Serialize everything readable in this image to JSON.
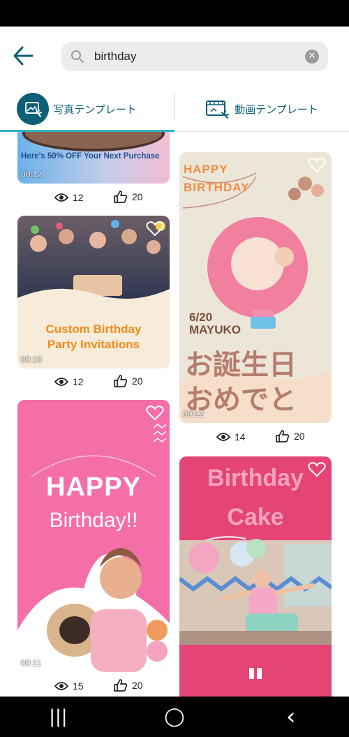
{
  "search": {
    "query": "birthday",
    "clear_symbol": "✕"
  },
  "tabs": [
    {
      "label": "写真テンプレート",
      "active": true
    },
    {
      "label": "動画テンプレート",
      "active": false
    }
  ],
  "cards": [
    {
      "id": "c0",
      "text": "Here's 50% OFF Your Next Purchase",
      "duration": "00:12",
      "views": "12",
      "likes": "20"
    },
    {
      "id": "c1",
      "title_line1": "Custom Birthday",
      "title_line2": "Party Invitations",
      "duration": "00:10",
      "views": "12",
      "likes": "20"
    },
    {
      "id": "c2",
      "banner": "HAPPY BIRTHDAY",
      "date_name": "6/20 MAYUKO",
      "jp_line1": "お誕生日",
      "jp_line2": "おめでとう!",
      "duration": "00:12",
      "views": "14",
      "likes": "20"
    },
    {
      "id": "c3",
      "line1": "HAPPY",
      "line2": "Birthday!!",
      "duration": "00:11",
      "views": "15",
      "likes": "20"
    },
    {
      "id": "c4",
      "line1": "Birthday",
      "line2": "Cake"
    }
  ],
  "navbar": {
    "recents": "|||",
    "home": "◯",
    "back": "‹"
  },
  "colors": {
    "accent": "#0b5f77",
    "tab_indicator": "#2fb3c9",
    "pink": "#f46ea8",
    "magenta": "#e54476"
  }
}
